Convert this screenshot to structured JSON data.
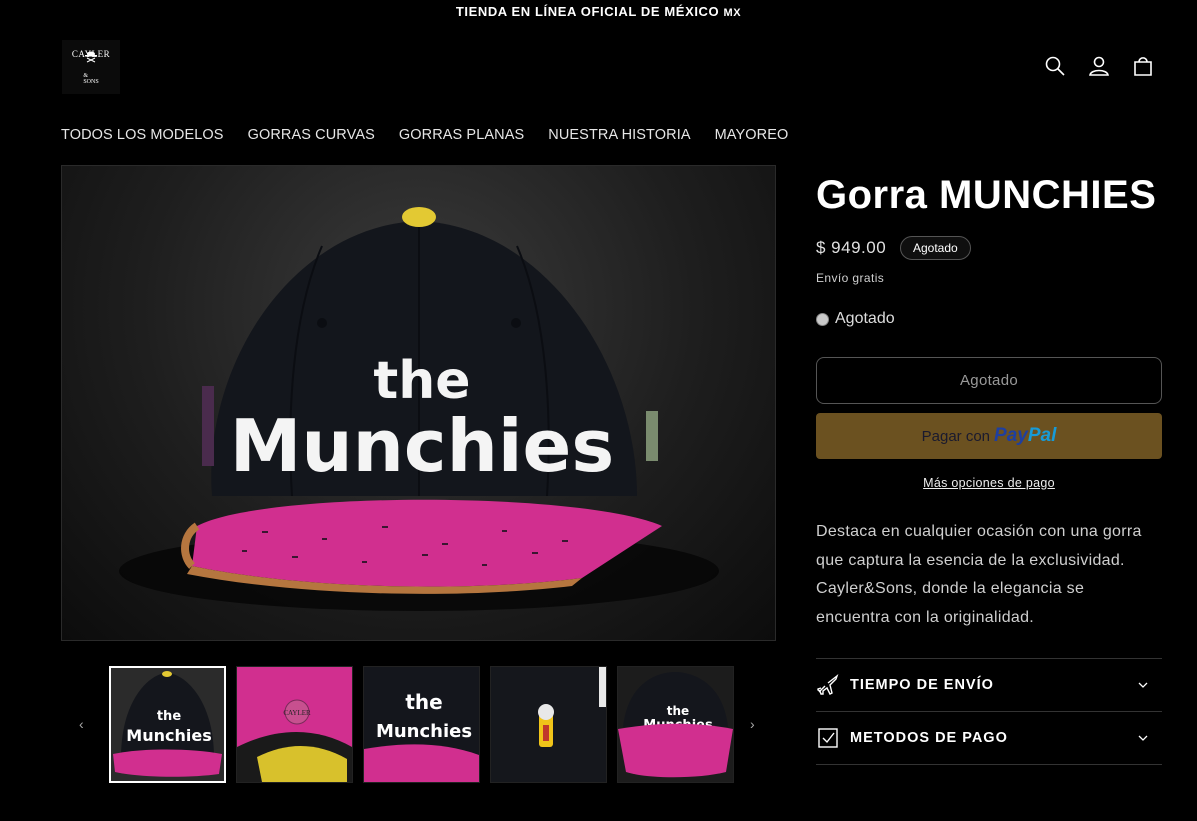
{
  "announcement": {
    "text": "TIENDA EN LÍNEA OFICIAL DE MÉXICO 🇲🇽",
    "flag": "MX"
  },
  "logo": {
    "line1": "CAYLER",
    "line2": "SONS",
    "amp": "&"
  },
  "header": {
    "icons": [
      "search-icon",
      "account-icon",
      "cart-icon"
    ]
  },
  "nav": {
    "items": [
      "TODOS LOS MODELOS",
      "GORRAS CURVAS",
      "GORRAS PLANAS",
      "NUESTRA HISTORIA",
      "MAYOREO"
    ]
  },
  "product": {
    "title": "Gorra MUNCHIES",
    "price": "$ 949.00",
    "badge": "Agotado",
    "shipping": "Envío gratis",
    "variant_option": "Agotado",
    "add_to_cart": "Agotado",
    "paypal_prefix": "Pagar con",
    "paypal_logo_a": "Pay",
    "paypal_logo_b": "Pal",
    "more_options": "Más opciones de pago",
    "description": "Destaca en cualquier ocasión con una gorra que captura la esencia de la exclusividad. Cayler&Sons, donde la elegancia se encuentra con la originalidad.",
    "cap_text_1": "the",
    "cap_text_2": "Munchies"
  },
  "accordion": [
    {
      "label": "TIEMPO DE ENVÍO",
      "icon": "plane-icon"
    },
    {
      "label": "METODOS DE PAGO",
      "icon": "checkbox-icon"
    }
  ],
  "gallery": {
    "thumb_count": 5,
    "selected": 0
  },
  "colors": {
    "paypal": "#6b5120",
    "donut_pink": "#d12f8f",
    "bg": "#000000"
  }
}
